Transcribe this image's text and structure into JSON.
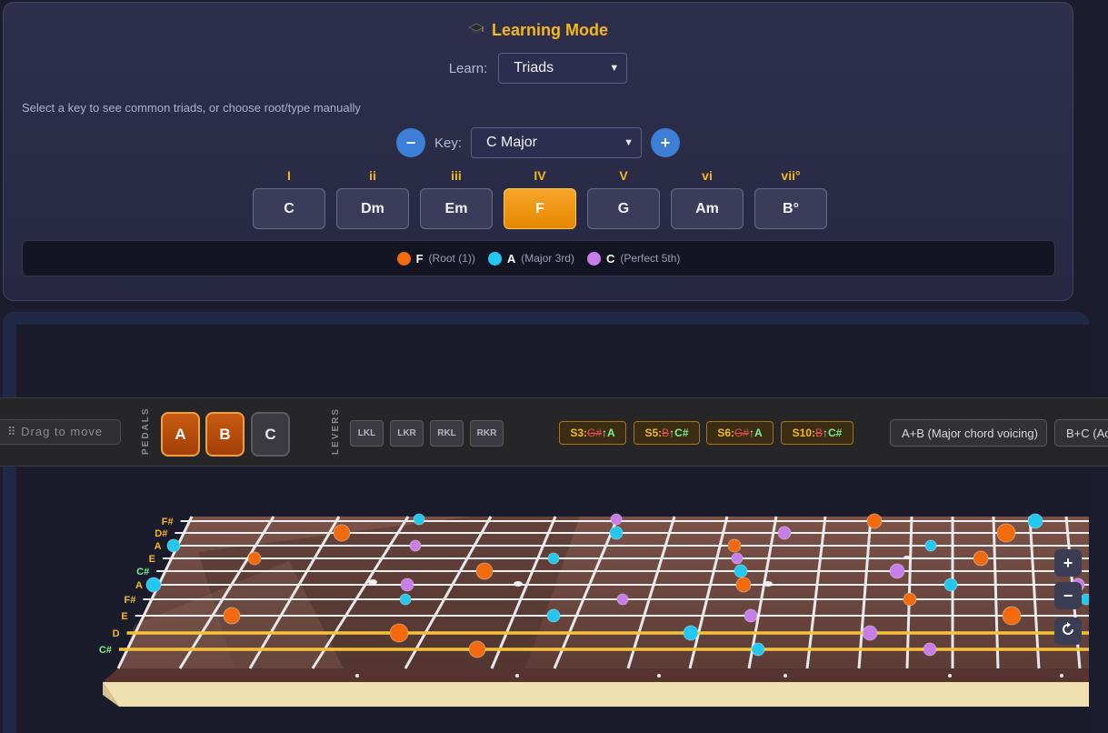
{
  "learning": {
    "title": "Learning Mode",
    "cap_icon": "graduation-cap-icon",
    "learn_label": "Learn:",
    "learn_value": "Triads",
    "hint": "Select a key to see common triads, or choose root/type manually",
    "key_label": "Key:",
    "key_value": "C Major",
    "minus": "−",
    "plus": "+"
  },
  "chords": [
    {
      "numeral": "I",
      "name": "C"
    },
    {
      "numeral": "ii",
      "name": "Dm"
    },
    {
      "numeral": "iii",
      "name": "Em"
    },
    {
      "numeral": "IV",
      "name": "F"
    },
    {
      "numeral": "V",
      "name": "G"
    },
    {
      "numeral": "vi",
      "name": "Am"
    },
    {
      "numeral": "vii°",
      "name": "B°"
    }
  ],
  "active_chord": "F",
  "legend": [
    {
      "note": "F",
      "desc": "(Root (1))",
      "color": "#f26a0c"
    },
    {
      "note": "A",
      "desc": "(Major 3rd)",
      "color": "#22c8f0"
    },
    {
      "note": "C",
      "desc": "(Perfect 5th)",
      "color": "#c77ee8"
    }
  ],
  "toolbar": {
    "drag_label": "⠿ Drag to move",
    "pedals_label": "PEDALS",
    "pedals": [
      {
        "label": "A",
        "engaged": true
      },
      {
        "label": "B",
        "engaged": true
      },
      {
        "label": "C",
        "engaged": false
      }
    ],
    "levers_label": "LEVERS",
    "levers": [
      "LKL",
      "LKR",
      "RKL",
      "RKR"
    ],
    "changes": [
      {
        "string": "S3:",
        "from": "G#",
        "to": "A"
      },
      {
        "string": "S5:",
        "from": "B",
        "to": "C#"
      },
      {
        "string": "S6:",
        "from": "G#",
        "to": "A"
      },
      {
        "string": "S10:",
        "from": "B",
        "to": "C#"
      }
    ],
    "arrow": "↑",
    "voicings": [
      "A+B (Major chord voicing)",
      "B+C (Ac"
    ]
  },
  "fretboard": {
    "string_labels": [
      "F#",
      "D#",
      "A",
      "E",
      "C#",
      "A",
      "F#",
      "E",
      "D",
      "C#"
    ],
    "zoom_in": "+",
    "zoom_out": "−",
    "reset_icon": "reset-icon"
  },
  "colors": {
    "accent": "#f5b81a",
    "root": "#f26a0c",
    "third": "#22c8f0",
    "fifth": "#c77ee8"
  }
}
